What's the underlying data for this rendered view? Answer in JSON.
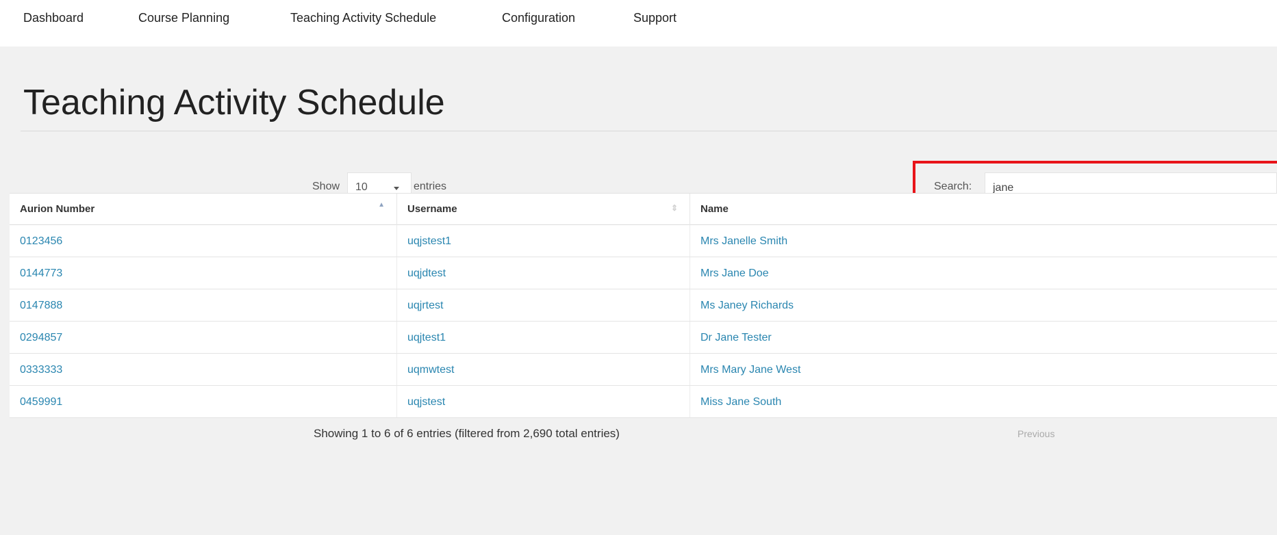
{
  "nav": {
    "items": [
      "Dashboard",
      "Course Planning",
      "Teaching Activity Schedule",
      "Configuration",
      "Support"
    ]
  },
  "page": {
    "title": "Teaching Activity Schedule"
  },
  "length_control": {
    "show_label": "Show",
    "selected": "10",
    "entries_label": "entries"
  },
  "search": {
    "label": "Search:",
    "value": "jane"
  },
  "table": {
    "columns": [
      "Aurion Number",
      "Username",
      "Name"
    ],
    "rows": [
      [
        "0123456",
        "uqjstest1",
        "Mrs Janelle Smith"
      ],
      [
        "0144773",
        "uqjdtest",
        "Mrs Jane Doe"
      ],
      [
        "0147888",
        "uqjrtest",
        "Ms Janey Richards"
      ],
      [
        "0294857",
        "uqjtest1",
        "Dr Jane Tester"
      ],
      [
        "0333333",
        "uqmwtest",
        "Mrs Mary Jane West"
      ],
      [
        "0459991",
        "uqjstest",
        "Miss Jane South"
      ]
    ]
  },
  "footer": {
    "info": "Showing 1 to 6 of 6 entries (filtered from 2,690 total entries)",
    "previous_label": "Previous"
  },
  "colors": {
    "link": "#2a86b0",
    "highlight": "#e8141a",
    "panel_bg": "#f1f1f1"
  }
}
